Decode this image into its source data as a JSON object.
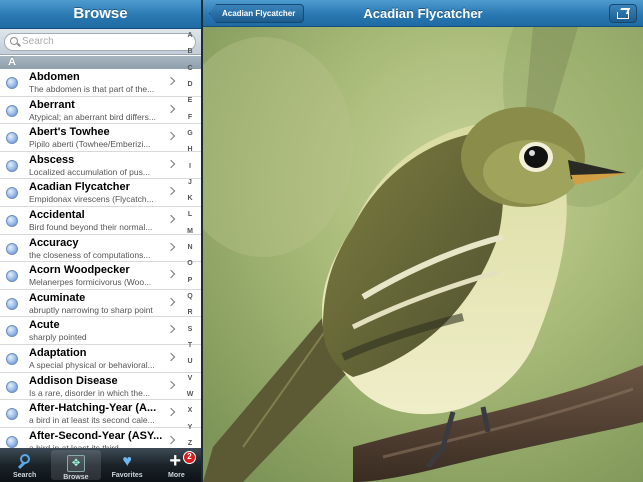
{
  "left_nav": {
    "title": "Browse"
  },
  "search": {
    "placeholder": "Search"
  },
  "section": {
    "letter": "A"
  },
  "entries": [
    {
      "title": "Abdomen",
      "subtitle": "The abdomen is that part of the..."
    },
    {
      "title": "Aberrant",
      "subtitle": "Atypical; an aberrant bird differs..."
    },
    {
      "title": "Abert's Towhee",
      "subtitle": "Pipilo aberti  (Towhee/Emberizi..."
    },
    {
      "title": "Abscess",
      "subtitle": "Localized accumulation of pus..."
    },
    {
      "title": "Acadian Flycatcher",
      "subtitle": "Empidonax virescens  (Flycatch..."
    },
    {
      "title": "Accidental",
      "subtitle": "Bird found beyond their normal..."
    },
    {
      "title": "Accuracy",
      "subtitle": "the closeness of computations..."
    },
    {
      "title": "Acorn Woodpecker",
      "subtitle": "Melanerpes formicivorus  (Woo..."
    },
    {
      "title": "Acuminate",
      "subtitle": "abruptly narrowing to sharp point"
    },
    {
      "title": "Acute",
      "subtitle": "sharply pointed"
    },
    {
      "title": "Adaptation",
      "subtitle": "A special physical or behavioral..."
    },
    {
      "title": "Addison Disease",
      "subtitle": "Is a rare, disorder in which the..."
    },
    {
      "title": "After-Hatching-Year (A...",
      "subtitle": "a bird in at least its second cale..."
    },
    {
      "title": "After-Second-Year (ASY...",
      "subtitle": "a bird in at least its third..."
    }
  ],
  "index_letters": [
    "A",
    "B",
    "C",
    "D",
    "E",
    "F",
    "G",
    "H",
    "I",
    "J",
    "K",
    "L",
    "M",
    "N",
    "O",
    "P",
    "Q",
    "R",
    "S",
    "T",
    "U",
    "V",
    "W",
    "X",
    "Y",
    "Z"
  ],
  "tabs": [
    {
      "label": "Search",
      "icon": "search-icon"
    },
    {
      "label": "Browse",
      "icon": "browse-icon"
    },
    {
      "label": "Favorites",
      "icon": "heart-icon"
    },
    {
      "label": "More",
      "icon": "plus-icon"
    }
  ],
  "more_badge": "2",
  "right_nav": {
    "title": "Acadian Flycatcher",
    "back_label": "Acadian Flycatcher"
  },
  "colors": {
    "nav_blue": "#2a79b3",
    "tab_dark": "#1b2329",
    "badge_red": "#d81e1e"
  }
}
